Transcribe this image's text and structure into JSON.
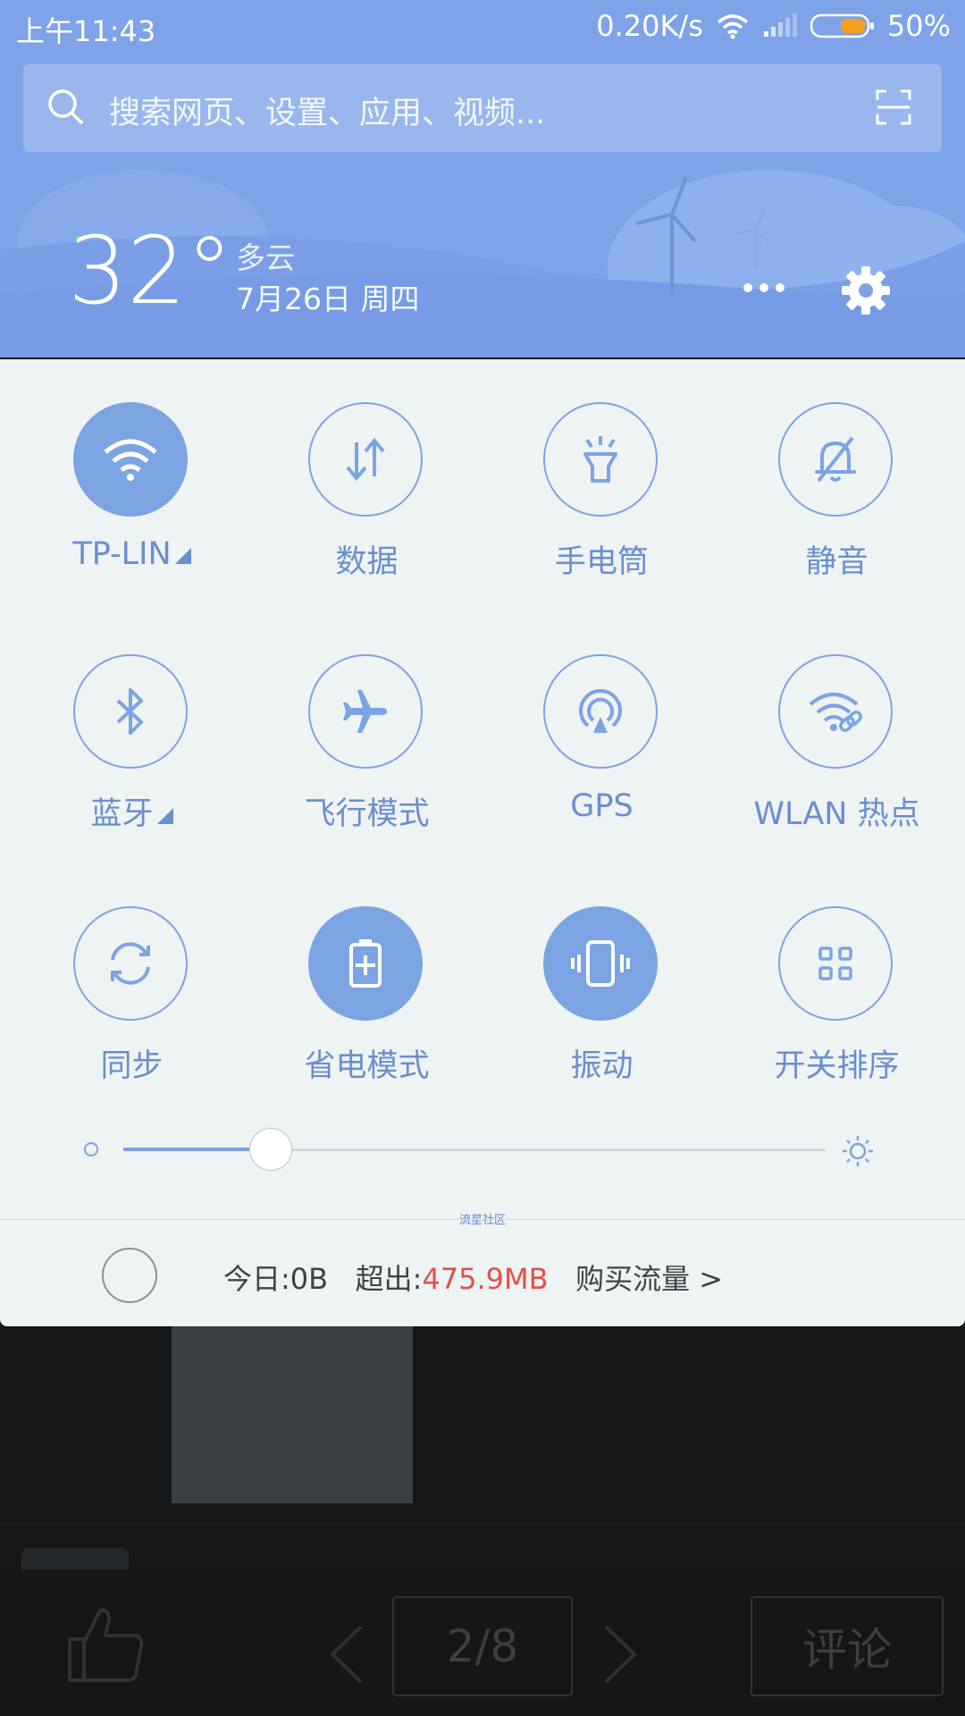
{
  "status_bar": {
    "time": "上午11:43",
    "net_speed": "0.20K/s",
    "battery": "50%",
    "icons": [
      "wifi-icon",
      "signal-icon",
      "battery-icon"
    ]
  },
  "search": {
    "placeholder": "搜索网页、设置、应用、视频...",
    "icons": [
      "search-icon",
      "scan-icon"
    ]
  },
  "weather": {
    "temperature": "32°",
    "condition": "多云",
    "date": "7月26日 周四"
  },
  "header_icons": [
    "more-icon",
    "settings-gear-icon"
  ],
  "toggles": [
    {
      "label": "TP-LIN",
      "icon": "wifi-icon",
      "on": true,
      "expand": true
    },
    {
      "label": "数据",
      "icon": "mobile-data-icon",
      "on": false,
      "expand": false
    },
    {
      "label": "手电筒",
      "icon": "flashlight-icon",
      "on": false,
      "expand": false
    },
    {
      "label": "静音",
      "icon": "mute-bell-icon",
      "on": false,
      "expand": false
    },
    {
      "label": "蓝牙",
      "icon": "bluetooth-icon",
      "on": false,
      "expand": true
    },
    {
      "label": "飞行模式",
      "icon": "airplane-icon",
      "on": false,
      "expand": false
    },
    {
      "label": "GPS",
      "icon": "gps-icon",
      "on": false,
      "expand": false
    },
    {
      "label": "WLAN 热点",
      "icon": "hotspot-icon",
      "on": false,
      "expand": false
    },
    {
      "label": "同步",
      "icon": "sync-icon",
      "on": false,
      "expand": false
    },
    {
      "label": "省电模式",
      "icon": "battery-saver-icon",
      "on": true,
      "expand": false
    },
    {
      "label": "振动",
      "icon": "vibrate-icon",
      "on": true,
      "expand": false
    },
    {
      "label": "开关排序",
      "icon": "grid-icon",
      "on": false,
      "expand": false
    }
  ],
  "watermark": "流星社区",
  "brightness": {
    "level": 0.21
  },
  "traffic": {
    "today_label": "今日:",
    "today_value": "0B",
    "over_label": "超出:",
    "over_value": "475.9MB",
    "buy_label": "购买流量 >"
  },
  "background_app": {
    "pager": "2/8",
    "comment_button": "评论",
    "accent": "#7da4e2",
    "over_color": "#e2504a"
  }
}
